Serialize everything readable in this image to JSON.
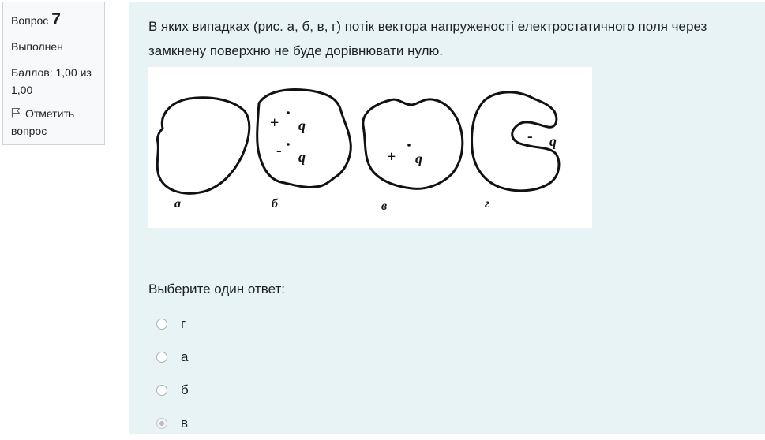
{
  "info": {
    "question_label": "Вопрос",
    "question_number": "7",
    "state": "Выполнен",
    "grade": "Баллов: 1,00 из 1,00",
    "flag_label": "Отметить вопрос"
  },
  "question": {
    "text": "В яких випадках (рис. а, б, в, г) потік вектора напруженості електростатичного поля через замкнену поверхню не буде дорівнювати нулю.",
    "figure": {
      "labels": [
        "а",
        "б",
        "в",
        "г"
      ],
      "charges": [
        {
          "sign": "+",
          "name": "q"
        },
        {
          "sign": "-",
          "name": "q"
        },
        {
          "sign": "+",
          "name": "q"
        },
        {
          "sign": "-",
          "name": "q"
        }
      ]
    }
  },
  "answer_prompt": "Выберите один ответ:",
  "options": [
    {
      "label": "г",
      "checked": false
    },
    {
      "label": "а",
      "checked": false
    },
    {
      "label": "б",
      "checked": false
    },
    {
      "label": "в",
      "checked": true
    }
  ]
}
